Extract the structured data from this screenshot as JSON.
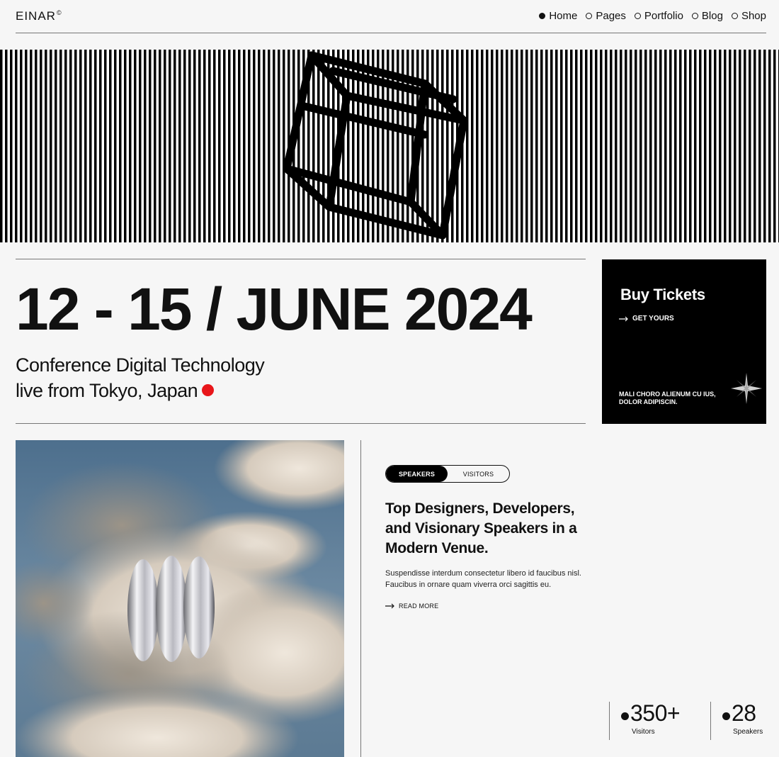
{
  "header": {
    "logo": "EINAR",
    "logo_mark": "©",
    "nav": [
      {
        "label": "Home",
        "active": true
      },
      {
        "label": "Pages",
        "active": false
      },
      {
        "label": "Portfolio",
        "active": false
      },
      {
        "label": "Blog",
        "active": false
      },
      {
        "label": "Shop",
        "active": false
      }
    ]
  },
  "event": {
    "dates": "12 - 15 / JUNE 2024",
    "subtitle_line1": "Conference Digital Technology",
    "subtitle_line2": "live from Tokyo, Japan"
  },
  "tickets": {
    "title": "Buy Tickets",
    "link": "GET YOURS",
    "note": "MALI CHORO ALIENUM CU IUS, DOLOR ADIPISCIN."
  },
  "tabs": [
    {
      "label": "SPEAKERS",
      "active": true
    },
    {
      "label": "VISITORS",
      "active": false
    }
  ],
  "content": {
    "heading": "Top Designers, Developers, and Visionary Speakers in a Modern Venue.",
    "body": "Suspendisse interdum consectetur libero id faucibus nisl. Faucibus in ornare quam viverra orci sagittis eu.",
    "read_more": "READ MORE"
  },
  "stats": [
    {
      "value": "350+",
      "label": "Visitors"
    },
    {
      "value": "28",
      "label": "Speakers"
    }
  ],
  "colors": {
    "accent_red": "#e8161a",
    "background": "#f6f6f6",
    "black": "#000000"
  },
  "icons": {
    "arrow": "arrow-right-icon",
    "star": "sparkle-star-icon"
  }
}
